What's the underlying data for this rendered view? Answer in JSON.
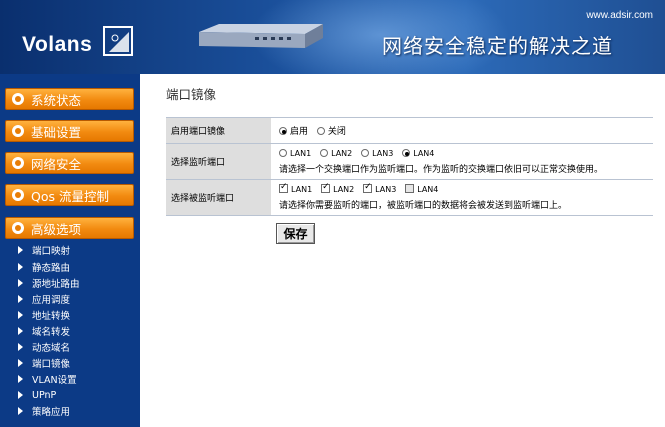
{
  "header": {
    "brand": "Volans",
    "url": "www.adsir.com",
    "slogan": "网络安全稳定的解决之道"
  },
  "sidebar": {
    "main_items": [
      {
        "label": "系统状态"
      },
      {
        "label": "基础设置"
      },
      {
        "label": "网络安全"
      },
      {
        "label": "Qos 流量控制"
      },
      {
        "label": "高级选项"
      }
    ],
    "sub_items": [
      {
        "label": "端口映射"
      },
      {
        "label": "静态路由"
      },
      {
        "label": "源地址路由"
      },
      {
        "label": "应用调度"
      },
      {
        "label": "地址转换"
      },
      {
        "label": "域名转发"
      },
      {
        "label": "动态域名"
      },
      {
        "label": "端口镜像"
      },
      {
        "label": "VLAN设置"
      },
      {
        "label": "UPnP"
      },
      {
        "label": "策略应用"
      }
    ]
  },
  "main": {
    "title": "端口镜像",
    "rows": {
      "enable": {
        "label": "启用端口镜像",
        "options": [
          {
            "label": "启用",
            "selected": true
          },
          {
            "label": "关闭",
            "selected": false
          }
        ]
      },
      "monitor": {
        "label": "选择监听端口",
        "options": [
          {
            "label": "LAN1",
            "selected": false
          },
          {
            "label": "LAN2",
            "selected": false
          },
          {
            "label": "LAN3",
            "selected": false
          },
          {
            "label": "LAN4",
            "selected": true
          }
        ],
        "hint": "请选择一个交换端口作为监听端口。作为监听的交换端口依旧可以正常交换使用。"
      },
      "monitored": {
        "label": "选择被监听端口",
        "options": [
          {
            "label": "LAN1",
            "checked": true
          },
          {
            "label": "LAN2",
            "checked": true
          },
          {
            "label": "LAN3",
            "checked": true
          },
          {
            "label": "LAN4",
            "checked": false
          }
        ],
        "hint": "请选择你需要监听的端口，被监听端口的数据将会被发送到监听端口上。"
      }
    },
    "save_label": "保存"
  },
  "colors": {
    "sidebar_bg": "#0c3a86",
    "menu_orange": "#f28a10",
    "label_cell_bg": "#dedede"
  }
}
